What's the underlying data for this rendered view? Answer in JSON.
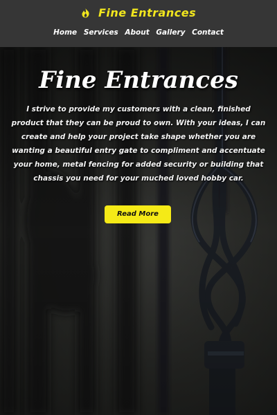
{
  "header": {
    "brand": "Fine Entrances",
    "icon": "flame-icon",
    "accent_color": "#f2e71e",
    "nav": [
      "Home",
      "Services",
      "About",
      "Gallery",
      "Contact"
    ]
  },
  "hero": {
    "title": "Fine Entrances",
    "description": "I strive to provide my customers with a clean, finished product that they can be proud to own. With your ideas, I can create and help your project take shape whether you are wanting a beautiful entry gate to compliment and accentuate your home, metal fencing for added security or building that chassis you need for your muched loved hobby car.",
    "button_label": "Read More",
    "button_color": "#f5ea17"
  }
}
